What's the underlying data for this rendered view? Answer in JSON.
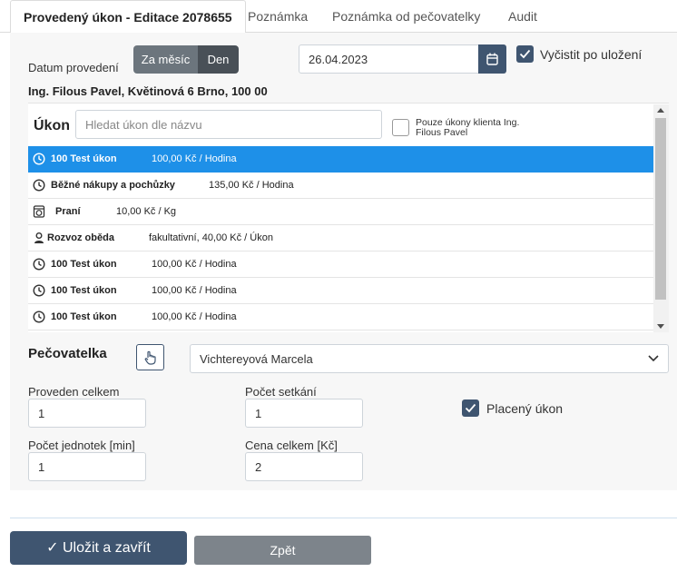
{
  "tabs": [
    {
      "label": "Provedený úkon - Editace 2078655",
      "active": true
    },
    {
      "label": "Poznámka",
      "active": false
    },
    {
      "label": "Poznámka od pečovatelky",
      "active": false
    },
    {
      "label": "Audit",
      "active": false
    }
  ],
  "form": {
    "date_label": "Datum provedení",
    "mode_month": "Za měsíc",
    "mode_day": "Den",
    "date_value": "26.04.2023",
    "clear_after_save": {
      "label": "Vyčistit po uložení",
      "checked": true
    },
    "client": "Ing. Filous Pavel, Květinová 6 Brno, 100 00"
  },
  "ukon": {
    "title": "Úkon",
    "search_placeholder": "Hledat úkon dle názvu",
    "only_client_line1": "Pouze úkony klienta Ing.",
    "only_client_line2": "Filous Pavel",
    "only_client_checked": false,
    "items": [
      {
        "icon": "clock-icon",
        "name": "100 Test úkon",
        "price": "100,00 Kč / Hodina",
        "selected": true
      },
      {
        "icon": "clock-icon",
        "name": "Běžné nákupy a pochůzky",
        "price": "135,00 Kč / Hodina",
        "selected": false
      },
      {
        "icon": "washing-machine-icon",
        "name": "Praní",
        "price": "10,00 Kč / Kg",
        "selected": false
      },
      {
        "icon": "person-icon",
        "name": "Rozvoz oběda",
        "price": "fakultativní, 40,00 Kč / Úkon",
        "selected": false
      },
      {
        "icon": "clock-icon",
        "name": "100 Test úkon",
        "price": "100,00 Kč / Hodina",
        "selected": false
      },
      {
        "icon": "clock-icon",
        "name": "100 Test úkon",
        "price": "100,00 Kč / Hodina",
        "selected": false
      },
      {
        "icon": "clock-icon",
        "name": "100 Test úkon",
        "price": "100,00 Kč / Hodina",
        "selected": false
      }
    ]
  },
  "pecovatelka": {
    "title": "Pečovatelka",
    "selected": "Vichtereyová Marcela"
  },
  "fields": {
    "proveden_celkem": {
      "label": "Proveden celkem",
      "value": "1"
    },
    "pocet_setkani": {
      "label": "Počet setkání",
      "value": "1"
    },
    "placeny_ukon": {
      "label": "Placený úkon",
      "checked": true
    },
    "pocet_jednotek": {
      "label": "Počet jednotek [min]",
      "value": "1"
    },
    "cena_celkem": {
      "label": "Cena celkem [Kč]",
      "value": "2"
    }
  },
  "actions": {
    "save_close": "✓ Uložit a zavřít",
    "back": "Zpět"
  },
  "colors": {
    "primary": "#3f5570",
    "selected_row": "#1e90e8",
    "secondary": "#7d848b"
  }
}
